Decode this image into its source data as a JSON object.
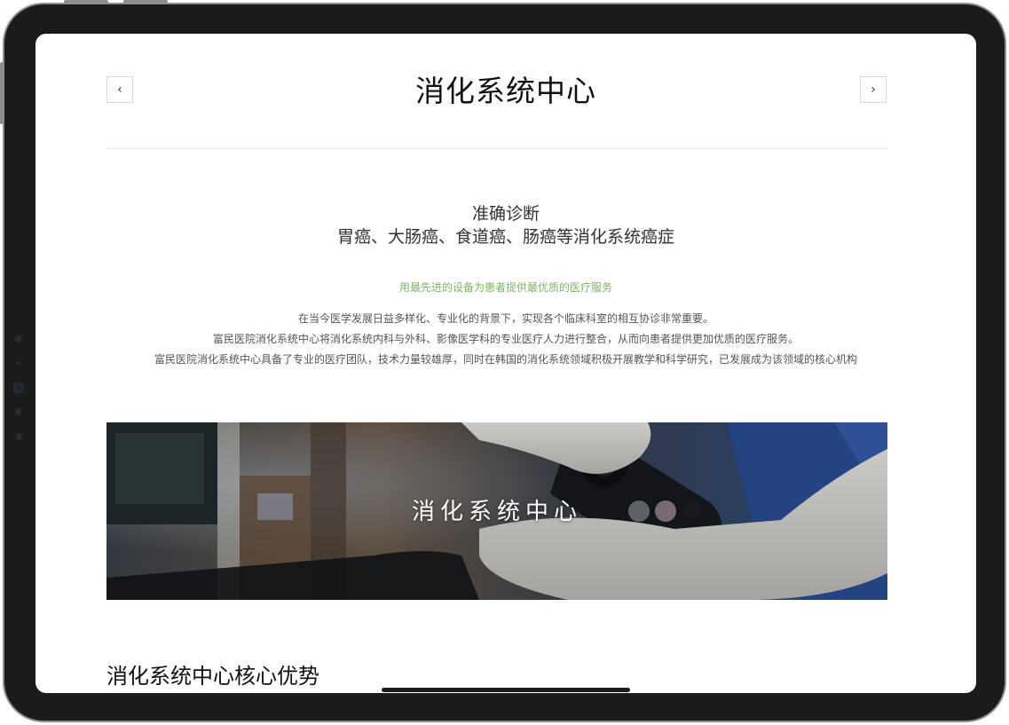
{
  "header": {
    "title": "消化系统中心",
    "prev_icon": "chevron-left-icon",
    "next_icon": "chevron-right-icon",
    "prev_glyph": "‹",
    "next_glyph": "›"
  },
  "intro": {
    "headline_line1": "准确诊断",
    "headline_line2": "胃癌、大肠癌、食道癌、肠癌等消化系统癌症",
    "slogan": "用最先进的设备为患者提供最优质的医疗服务",
    "paragraphs": [
      "在当今医学发展日益多样化、专业化的背景下，实现各个临床科室的相互协诊非常重要。",
      "富民医院消化系统中心将消化系统内科与外科、影像医学科的专业医疗人力进行整合，从而向患者提供更加优质的医疗服务。",
      "富民医院消化系统中心具备了专业的医疗团队，技术力量较雄厚，同时在韩国的消化系统领域积极开展教学和科学研究，已发展成为该领域的核心机构"
    ]
  },
  "banner": {
    "title": "消化系统中心",
    "image": "endoscope-procedure-photo"
  },
  "section": {
    "title": "消化系统中心核心优势"
  },
  "colors": {
    "slogan": "#7fb46a",
    "frame": "#1b1b1b",
    "divider": "#e6e6e6"
  }
}
